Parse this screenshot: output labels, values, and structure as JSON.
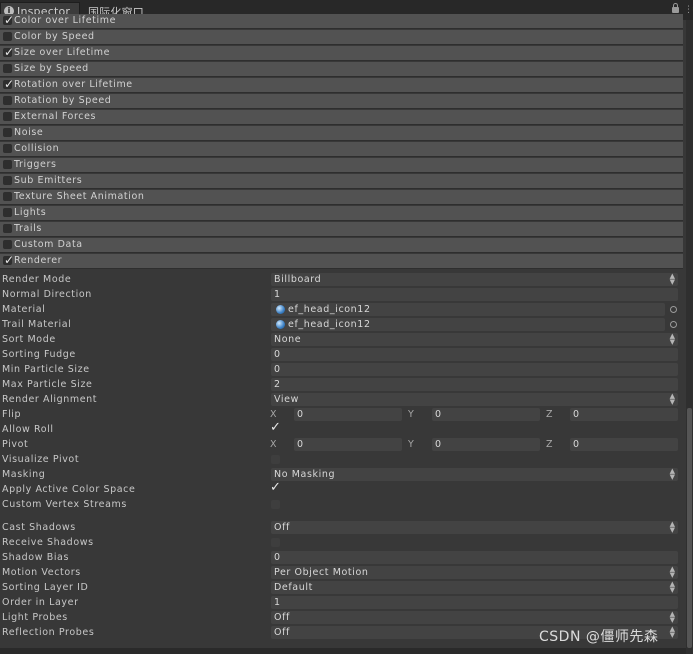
{
  "tabs": {
    "inspector": "Inspector",
    "window2": "国际化窗口",
    "info_icon": "info-icon"
  },
  "modules": [
    {
      "label": "Color over Lifetime",
      "enabled": true
    },
    {
      "label": "Color by Speed",
      "enabled": false
    },
    {
      "label": "Size over Lifetime",
      "enabled": true
    },
    {
      "label": "Size by Speed",
      "enabled": false
    },
    {
      "label": "Rotation over Lifetime",
      "enabled": true
    },
    {
      "label": "Rotation by Speed",
      "enabled": false
    },
    {
      "label": "External Forces",
      "enabled": false
    },
    {
      "label": "Noise",
      "enabled": false
    },
    {
      "label": "Collision",
      "enabled": false
    },
    {
      "label": "Triggers",
      "enabled": false
    },
    {
      "label": "Sub Emitters",
      "enabled": false
    },
    {
      "label": "Texture Sheet Animation",
      "enabled": false
    },
    {
      "label": "Lights",
      "enabled": false
    },
    {
      "label": "Trails",
      "enabled": false
    },
    {
      "label": "Custom Data",
      "enabled": false
    },
    {
      "label": "Renderer",
      "enabled": true
    }
  ],
  "renderer": {
    "render_mode": {
      "label": "Render Mode",
      "value": "Billboard"
    },
    "normal_direction": {
      "label": "Normal Direction",
      "value": "1"
    },
    "material": {
      "label": "Material",
      "value": "ef_head_icon12"
    },
    "trail_material": {
      "label": "Trail Material",
      "value": "ef_head_icon12"
    },
    "sort_mode": {
      "label": "Sort Mode",
      "value": "None"
    },
    "sorting_fudge": {
      "label": "Sorting Fudge",
      "value": "0"
    },
    "min_particle_size": {
      "label": "Min Particle Size",
      "value": "0"
    },
    "max_particle_size": {
      "label": "Max Particle Size",
      "value": "2"
    },
    "render_alignment": {
      "label": "Render Alignment",
      "value": "View"
    },
    "flip": {
      "label": "Flip",
      "x_label": "X",
      "x": "0",
      "y_label": "Y",
      "y": "0",
      "z_label": "Z",
      "z": "0"
    },
    "allow_roll": {
      "label": "Allow Roll",
      "checked": true
    },
    "pivot": {
      "label": "Pivot",
      "x_label": "X",
      "x": "0",
      "y_label": "Y",
      "y": "0",
      "z_label": "Z",
      "z": "0"
    },
    "visualize_pivot": {
      "label": "Visualize Pivot",
      "checked": false
    },
    "masking": {
      "label": "Masking",
      "value": "No Masking"
    },
    "apply_active_color_space": {
      "label": "Apply Active Color Space",
      "checked": true
    },
    "custom_vertex_streams": {
      "label": "Custom Vertex Streams",
      "checked": false
    },
    "cast_shadows": {
      "label": "Cast Shadows",
      "value": "Off"
    },
    "receive_shadows": {
      "label": "Receive Shadows",
      "checked": false
    },
    "shadow_bias": {
      "label": "Shadow Bias",
      "value": "0"
    },
    "motion_vectors": {
      "label": "Motion Vectors",
      "value": "Per Object Motion"
    },
    "sorting_layer_id": {
      "label": "Sorting Layer ID",
      "value": "Default"
    },
    "order_in_layer": {
      "label": "Order in Layer",
      "value": "1"
    },
    "light_probes": {
      "label": "Light Probes",
      "value": "Off"
    },
    "reflection_probes": {
      "label": "Reflection Probes",
      "value": "Off"
    }
  },
  "watermark": "CSDN @僵师先森"
}
